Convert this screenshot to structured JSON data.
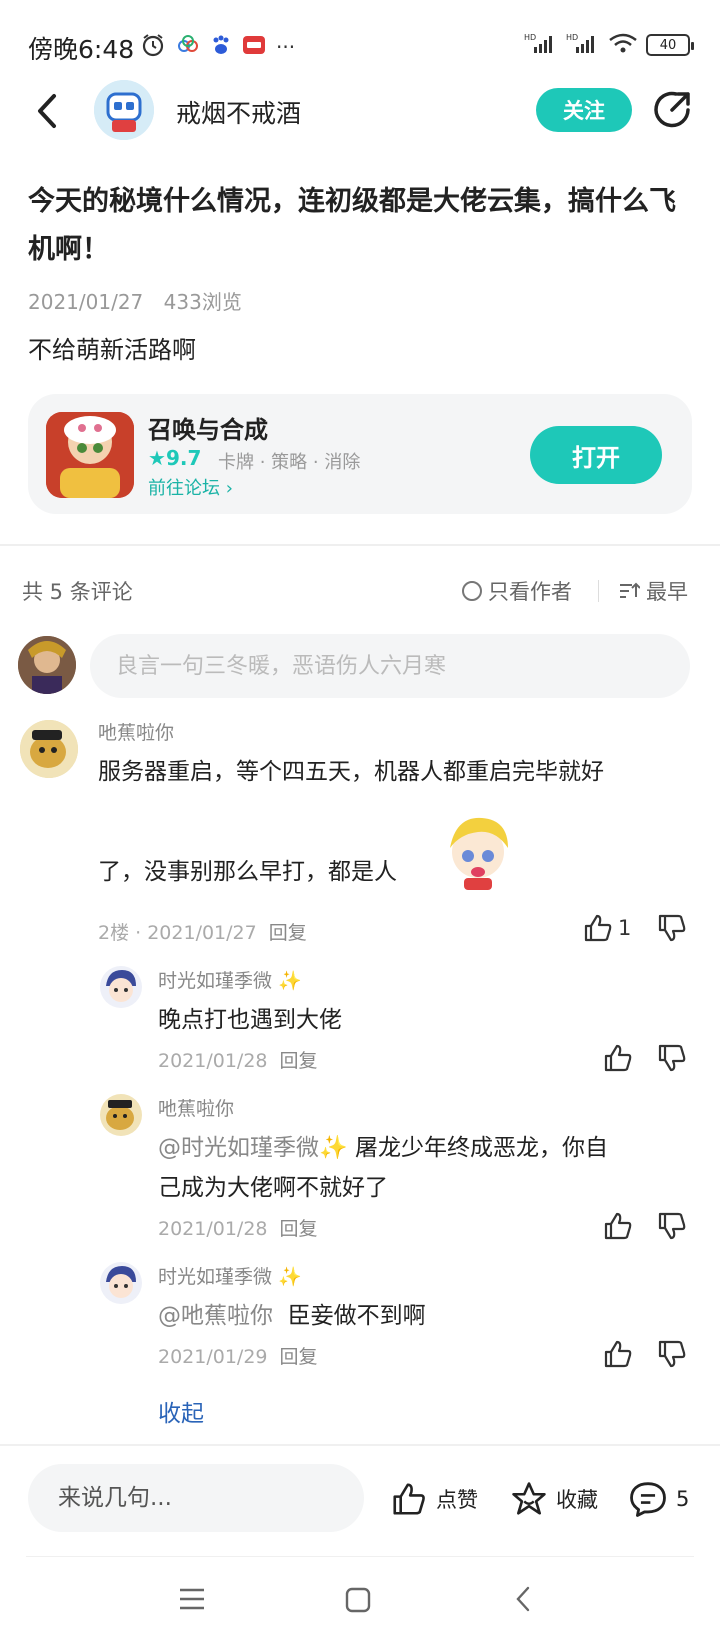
{
  "status_bar": {
    "time": "傍晚6:48",
    "notif_more": "···",
    "battery": "40"
  },
  "header": {
    "author_name": "戒烟不戒酒",
    "follow_label": "关注"
  },
  "post": {
    "title": "今天的秘境什么情况，连初级都是大佬云集，搞什么飞机啊！",
    "date": "2021/01/27",
    "views": "433浏览",
    "body": "不给萌新活路啊"
  },
  "game_card": {
    "name": "召唤与合成",
    "rating": "9.7",
    "tags": "卡牌 · 策略 · 消除",
    "forum_link": "前往论坛",
    "open_label": "打开"
  },
  "comments_header": {
    "count_label": "共 5 条评论",
    "only_author_label": "只看作者",
    "sort_label": "最早"
  },
  "comment_input": {
    "placeholder": "良言一句三冬暖，恶语伤人六月寒"
  },
  "comments": [
    {
      "user": "吔蕉啦你",
      "text_line1": "服务器重启，等个四五天，机器人都重启完毕就好",
      "text_line2": "了，没事别那么早打，都是人",
      "floor": "2楼",
      "date": "2021/01/27",
      "reply_label": "回复",
      "likes": "1"
    }
  ],
  "replies": [
    {
      "user": "时光如瑾季微",
      "text": "晚点打也遇到大佬",
      "date": "2021/01/28",
      "reply_label": "回复"
    },
    {
      "user": "吔蕉啦你",
      "mention": "@时光如瑾季微",
      "text_line1": "屠龙少年终成恶龙，你自",
      "text_line2": "己成为大佬啊不就好了",
      "date": "2021/01/28",
      "reply_label": "回复"
    },
    {
      "user": "时光如瑾季微",
      "mention": "@吔蕉啦你",
      "text": "臣妾做不到啊",
      "date": "2021/01/29",
      "reply_label": "回复"
    }
  ],
  "collapse_label": "收起",
  "bottom_bar": {
    "input_placeholder": "来说几句...",
    "like_label": "点赞",
    "favorite_label": "收藏",
    "comment_count": "5"
  },
  "colors": {
    "accent": "#1ec8b8",
    "link": "#2a64b8"
  }
}
